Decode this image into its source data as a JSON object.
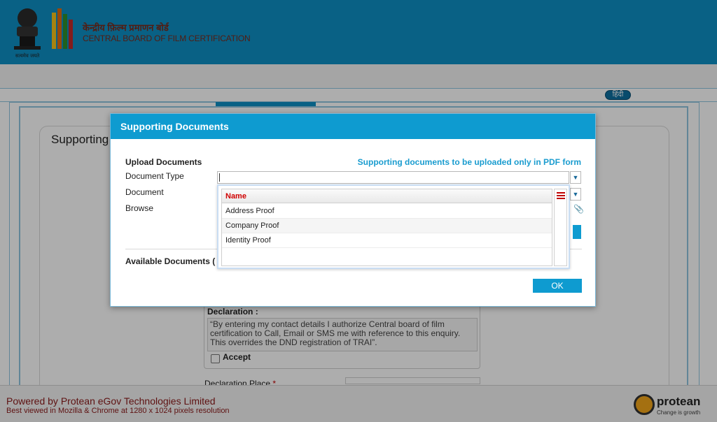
{
  "header": {
    "org_hindi": "केन्द्रीय फ़िल्म प्रमाणन बोर्ड",
    "org_english": "CENTRAL BOARD OF FILM CERTIFICATION",
    "language_button": "हिंदी"
  },
  "page": {
    "section_title": "Supporting",
    "declaration": {
      "title": "Declaration :",
      "text": "“By entering my contact details I authorize Central board of film certification to Call, Email or SMS me with reference to this enquiry. This overrides the DND registration of TRAI”.",
      "accept_label": "Accept",
      "place_label": "Declaration Place",
      "required_mark": "*"
    }
  },
  "modal": {
    "title": "Supporting Documents",
    "upload_heading": "Upload Documents",
    "pdf_note": "Supporting documents to be uploaded only in PDF form",
    "document_type_label": "Document Type",
    "document_label": "Document",
    "browse_label": "Browse",
    "available_documents_label": "Available Documents (",
    "ok_button": "OK",
    "document_type_value": "",
    "grid": {
      "column_header": "Name",
      "rows": [
        "Address Proof",
        "Company Proof",
        "Identity Proof"
      ]
    }
  },
  "footer": {
    "powered_by": "Powered by Protean eGov Technologies Limited",
    "best_viewed": "Best viewed in Mozilla & Chrome at 1280 x 1024 pixels resolution",
    "brand_name": "protean",
    "brand_tagline": "Change is growth"
  },
  "colors": {
    "header_blue": "#0e8fc4",
    "accent_blue": "#0e9bd0",
    "footer_text": "#8b1a1a",
    "grid_header_text": "#d00000"
  }
}
